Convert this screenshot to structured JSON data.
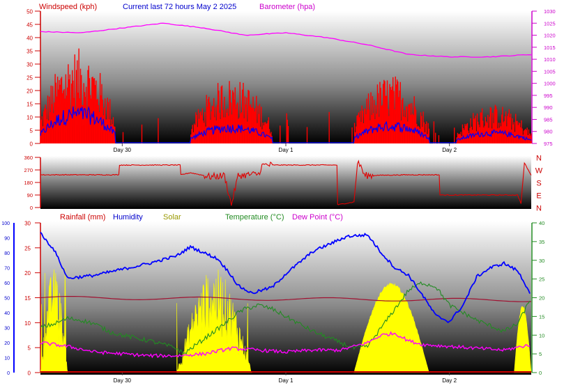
{
  "colors": {
    "wind": "#ff0000",
    "gust_fill": "#ff0000",
    "avg_wind": "#0000ff",
    "barometer": "#ff00ff",
    "direction": "#e00000",
    "rainfall": "#cc0000",
    "humidity": "#0000ff",
    "solar": "#ffff00",
    "temperature": "#228b22",
    "dewpoint": "#ff00ff",
    "title": "#0000cc",
    "chart_bg_top": "#ffffff",
    "chart_bg_bottom": "#000000"
  },
  "chart_data": [
    {
      "type": "line",
      "name": "wind-barometer",
      "title": "Current last 72 hours May 2 2025",
      "left_axis_label": "Windspeed (kph)",
      "right_axis_label": "Barometer (hpa)",
      "ylim_left": [
        0,
        50
      ],
      "yticks_left": [
        0,
        5,
        10,
        15,
        20,
        25,
        30,
        35,
        40,
        45,
        50
      ],
      "ylim_right": [
        975,
        1030
      ],
      "yticks_right": [
        975,
        980,
        985,
        990,
        995,
        1000,
        1005,
        1010,
        1015,
        1020,
        1025,
        1030
      ],
      "x_range_hours": [
        0,
        72
      ],
      "day_labels": [
        {
          "label": "Day 30",
          "hour": 12
        },
        {
          "label": "Day 1",
          "hour": 36
        },
        {
          "label": "Day 2",
          "hour": 60
        }
      ],
      "barometer": {
        "x": [
          0,
          6,
          12,
          18,
          24,
          30,
          36,
          42,
          48,
          54,
          60,
          66,
          72
        ],
        "y": [
          1021.5,
          1021,
          1023,
          1025,
          1023,
          1020,
          1021,
          1019,
          1016,
          1012,
          1011,
          1011,
          1012
        ]
      },
      "wind_activity": [
        {
          "start": 0,
          "end": 11,
          "gust_peak": 36,
          "avg_peak": 17
        },
        {
          "start": 22,
          "end": 34,
          "gust_peak": 25,
          "avg_peak": 9
        },
        {
          "start": 46,
          "end": 57,
          "gust_peak": 26,
          "avg_peak": 10
        },
        {
          "start": 61,
          "end": 72,
          "gust_peak": 15,
          "avg_peak": 6
        }
      ]
    },
    {
      "type": "line",
      "name": "wind-direction",
      "ylim": [
        0,
        360
      ],
      "yticks": [
        0,
        90,
        180,
        270,
        360
      ],
      "compass_labels": [
        "N",
        "W",
        "S",
        "E",
        "N"
      ],
      "x_range_hours": [
        0,
        72
      ],
      "direction": {
        "x": [
          0,
          11.5,
          11.6,
          20.5,
          20.6,
          22,
          25,
          27,
          28,
          29,
          32,
          32.5,
          33,
          43.5,
          43.6,
          46,
          46.5,
          47,
          47.5,
          54,
          58.5,
          58.6,
          70,
          70.5,
          71,
          72
        ],
        "y": [
          235,
          235,
          305,
          305,
          235,
          250,
          220,
          230,
          20,
          230,
          240,
          300,
          305,
          305,
          20,
          40,
          320,
          300,
          230,
          235,
          235,
          90,
          90,
          30,
          320,
          230
        ]
      }
    },
    {
      "type": "line",
      "name": "rain-humidity-solar-temp",
      "series_labels": [
        "Rainfall (mm)",
        "Humidity",
        "Solar",
        "Temperature (°C)",
        "Dew Point (°C)"
      ],
      "ylim_outer_left": [
        0,
        100
      ],
      "yticks_outer_left": [
        0,
        10,
        20,
        30,
        40,
        50,
        60,
        70,
        80,
        90,
        100
      ],
      "ylim_left": [
        0,
        30
      ],
      "yticks_left": [
        0,
        5,
        10,
        15,
        20,
        25,
        30
      ],
      "ylim_right": [
        0,
        40
      ],
      "yticks_right": [
        0,
        5,
        10,
        15,
        20,
        25,
        30,
        35,
        40
      ],
      "x_range_hours": [
        0,
        72
      ],
      "day_labels": [
        {
          "label": "Day 30",
          "hour": 12
        },
        {
          "label": "Day 1",
          "hour": 36
        },
        {
          "label": "Day 2",
          "hour": 60
        }
      ],
      "humidity": {
        "x": [
          0,
          2,
          4,
          8,
          12,
          16,
          20,
          22,
          26,
          28,
          29,
          31,
          34,
          36,
          40,
          44,
          45,
          48,
          50,
          52,
          54,
          56,
          58,
          60,
          62,
          64,
          66,
          68,
          70,
          72
        ],
        "y": [
          93,
          82,
          63,
          65,
          69,
          73,
          78,
          84,
          76,
          65,
          58,
          53,
          57,
          66,
          81,
          89,
          91,
          92,
          80,
          70,
          65,
          52,
          38,
          34,
          45,
          64,
          70,
          73,
          68,
          52
        ]
      },
      "temperature_c": {
        "x": [
          0,
          2,
          4,
          6,
          8,
          10,
          12,
          16,
          20,
          21,
          24,
          27,
          29,
          30,
          32,
          34,
          36,
          40,
          44,
          46,
          48,
          50,
          52,
          54,
          56,
          58,
          60,
          64,
          68,
          70,
          72
        ],
        "y": [
          12,
          13,
          14.5,
          14,
          13,
          11,
          10,
          8.5,
          6.5,
          5,
          9,
          13,
          16,
          17,
          18,
          17,
          15,
          11,
          8,
          6.5,
          7,
          12,
          17,
          22,
          24,
          23,
          18,
          14,
          11,
          13,
          20
        ]
      },
      "dewpoint_c": {
        "x": [
          0,
          4,
          8,
          12,
          16,
          20,
          24,
          28,
          32,
          36,
          40,
          44,
          48,
          50,
          52,
          54,
          56,
          60,
          64,
          68,
          72
        ],
        "y": [
          8,
          7,
          5.5,
          5,
          4.5,
          4.5,
          5,
          6.5,
          6,
          5.5,
          6,
          6,
          8,
          10,
          10.5,
          8.5,
          7.5,
          7,
          6.5,
          6,
          7.5
        ]
      },
      "rainfall_mm": {
        "x": [
          0,
          24,
          24.01,
          72
        ],
        "y": [
          0,
          0,
          0,
          0
        ]
      },
      "baseline_rain_mm": {
        "x": [
          0,
          72
        ],
        "y": [
          15,
          14.5
        ]
      },
      "solar_periods": [
        {
          "start": 0,
          "end": 4,
          "peak_pct": 0.7,
          "spiky": true
        },
        {
          "start": 20,
          "end": 31,
          "peak_pct": 0.7,
          "spiky": true
        },
        {
          "start": 46,
          "end": 57,
          "peak_pct": 0.6,
          "spiky": false
        },
        {
          "start": 69.5,
          "end": 72,
          "peak_pct": 0.45,
          "spiky": false
        }
      ]
    }
  ]
}
